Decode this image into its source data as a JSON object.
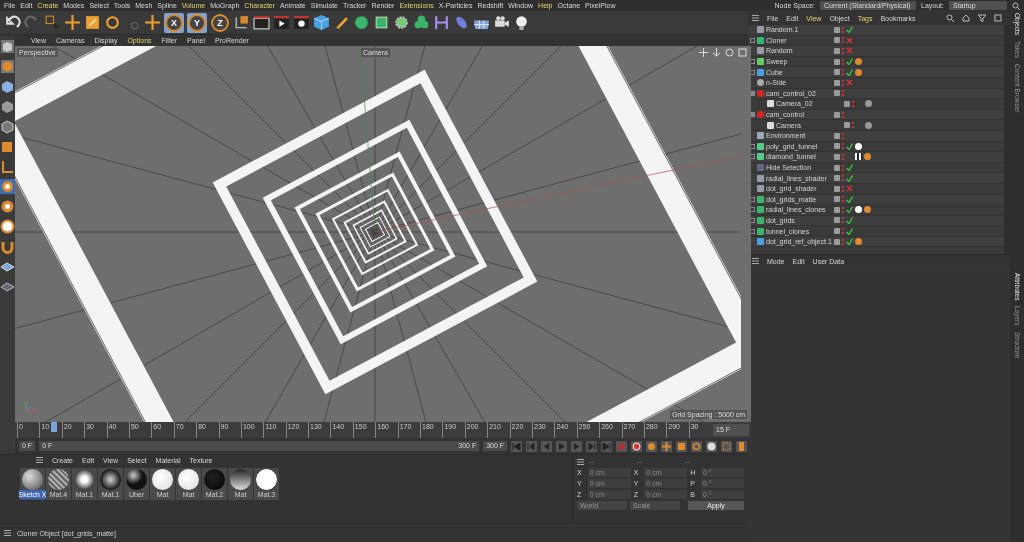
{
  "menubar": {
    "items": [
      {
        "label": "File",
        "highlighted": false
      },
      {
        "label": "Edit",
        "highlighted": false
      },
      {
        "label": "Create",
        "highlighted": true
      },
      {
        "label": "Modes",
        "highlighted": false
      },
      {
        "label": "Select",
        "highlighted": false
      },
      {
        "label": "Tools",
        "highlighted": false
      },
      {
        "label": "Mesh",
        "highlighted": false
      },
      {
        "label": "Spline",
        "highlighted": false
      },
      {
        "label": "Volume",
        "highlighted": true
      },
      {
        "label": "MoGraph",
        "highlighted": false
      },
      {
        "label": "Character",
        "highlighted": true
      },
      {
        "label": "Animate",
        "highlighted": false
      },
      {
        "label": "Simulate",
        "highlighted": false
      },
      {
        "label": "Tracker",
        "highlighted": false
      },
      {
        "label": "Render",
        "highlighted": false
      },
      {
        "label": "Extensions",
        "highlighted": true
      },
      {
        "label": "X-Particles",
        "highlighted": false
      },
      {
        "label": "Redshift",
        "highlighted": false
      },
      {
        "label": "Window",
        "highlighted": false
      },
      {
        "label": "Help",
        "highlighted": true
      },
      {
        "label": "Octane",
        "highlighted": false
      },
      {
        "label": "PixelPlow",
        "highlighted": false
      }
    ]
  },
  "node_space": {
    "label": "Node Space:",
    "value": "Current (Standard/Physical)"
  },
  "layout": {
    "label": "Layout:",
    "value": "Startup"
  },
  "toolbar": {
    "axis_locks": [
      {
        "label": "X",
        "selected": true
      },
      {
        "label": "Y",
        "selected": true
      },
      {
        "label": "Z",
        "selected": false
      }
    ]
  },
  "viewport": {
    "menu": [
      {
        "label": "View",
        "highlighted": false
      },
      {
        "label": "Cameras",
        "highlighted": false
      },
      {
        "label": "Display",
        "highlighted": false
      },
      {
        "label": "Options",
        "highlighted": true
      },
      {
        "label": "Filter",
        "highlighted": false
      },
      {
        "label": "Panel",
        "highlighted": false
      },
      {
        "label": "ProRender",
        "highlighted": false
      }
    ],
    "view_name": "Perspective",
    "camera_label": "Camera",
    "grid_spacing": "Grid Spacing : 5000 cm"
  },
  "timeline": {
    "ticks": [
      "0",
      "10",
      "20",
      "30",
      "40",
      "50",
      "60",
      "70",
      "80",
      "90",
      "100",
      "110",
      "120",
      "130",
      "140",
      "150",
      "160",
      "170",
      "180",
      "190",
      "200",
      "210",
      "220",
      "230",
      "240",
      "250",
      "260",
      "270",
      "280",
      "290",
      "30"
    ],
    "playhead": {
      "level": 0.05
    },
    "frame_field": "15 F"
  },
  "transport": {
    "start": "0 F",
    "current": "0 F",
    "range_end": "300 F",
    "end": "300 F"
  },
  "material_manager": {
    "menu": [
      "Create",
      "Edit",
      "View",
      "Select",
      "Material",
      "Texture"
    ],
    "materials": [
      {
        "name": "Sketch X",
        "kind": "sketch",
        "selected": true
      },
      {
        "name": "Mat.4",
        "kind": "grid",
        "selected": false
      },
      {
        "name": "Mat.1",
        "kind": "glow",
        "selected": false
      },
      {
        "name": "Mat.1",
        "kind": "dark",
        "selected": false
      },
      {
        "name": "Uber",
        "kind": "glossy",
        "selected": false
      },
      {
        "name": "Mat",
        "kind": "white",
        "selected": false
      },
      {
        "name": "Mat",
        "kind": "white",
        "selected": false
      },
      {
        "name": "Mat.2",
        "kind": "black",
        "selected": false
      },
      {
        "name": "Mat",
        "kind": "gradient",
        "selected": false
      },
      {
        "name": "Mat.3",
        "kind": "ring",
        "selected": false
      }
    ]
  },
  "coordinates": {
    "headers": [
      "--",
      "--",
      "--"
    ],
    "rows": [
      {
        "axis": "X",
        "position": "0 cm",
        "size_axis": "X",
        "size": "0 cm",
        "rotation_axis": "H",
        "rotation": "0 °"
      },
      {
        "axis": "Y",
        "position": "0 cm",
        "size_axis": "Y",
        "size": "0 cm",
        "rotation_axis": "P",
        "rotation": "0 °"
      },
      {
        "axis": "Z",
        "position": "0 cm",
        "size_axis": "Z",
        "size": "0 cm",
        "rotation_axis": "B",
        "rotation": "0 °"
      }
    ],
    "mode": "World",
    "size_mode": "Scale",
    "apply": "Apply"
  },
  "status_bar": {
    "text": "Cloner Object [dot_grids_matte]"
  },
  "object_manager": {
    "menu": [
      {
        "label": "File",
        "highlighted": false
      },
      {
        "label": "Edit",
        "highlighted": false
      },
      {
        "label": "View",
        "highlighted": true
      },
      {
        "label": "Object",
        "highlighted": false
      },
      {
        "label": "Tags",
        "highlighted": true
      },
      {
        "label": "Bookmarks",
        "highlighted": false
      }
    ],
    "objects": [
      {
        "name": "Random.1",
        "kind": "random",
        "enabled": true
      },
      {
        "name": "Cloner",
        "kind": "cloner",
        "expanded": false,
        "enabled": false
      },
      {
        "name": "Random",
        "kind": "random",
        "enabled": false
      },
      {
        "name": "Sweep",
        "kind": "sweep",
        "expanded": false,
        "enabled": true,
        "tags": [
          {
            "kind": "phong"
          }
        ]
      },
      {
        "name": "Cube",
        "kind": "cube",
        "expanded": false,
        "enabled": true,
        "tags": [
          {
            "kind": "phong"
          }
        ]
      },
      {
        "name": "n-Side",
        "kind": "spline",
        "enabled": false
      },
      {
        "name": "cam_control_02",
        "kind": "null",
        "expanded": true,
        "children": [
          {
            "name": "Camera_02",
            "kind": "camera",
            "tags": [
              {
                "kind": "target"
              }
            ]
          }
        ]
      },
      {
        "name": "cam_control",
        "kind": "null",
        "expanded": true,
        "children": [
          {
            "name": "Camera",
            "kind": "camera",
            "tags": [
              {
                "kind": "target"
              }
            ]
          }
        ]
      },
      {
        "name": "Environment",
        "kind": "environment"
      },
      {
        "name": "poly_grid_tunnel",
        "kind": "instance",
        "expanded": false,
        "enabled": true,
        "tags": [
          {
            "kind": "material"
          }
        ]
      },
      {
        "name": "diamond_tunnel",
        "kind": "instance",
        "expanded": false,
        "tags": [
          {
            "kind": "checker"
          },
          {
            "kind": "phong"
          }
        ]
      },
      {
        "name": "Hide Selection",
        "kind": "display",
        "enabled": true
      },
      {
        "name": "radial_lines_shader",
        "kind": "shader",
        "enabled": true
      },
      {
        "name": "dot_grid_shader",
        "kind": "shader",
        "enabled": false
      },
      {
        "name": "dot_grids_matte",
        "kind": "cloner",
        "expanded": false,
        "enabled": true
      },
      {
        "name": "radial_lines_clones",
        "kind": "cloner",
        "expanded": false,
        "enabled": true,
        "tags": [
          {
            "kind": "material"
          },
          {
            "kind": "phong"
          }
        ]
      },
      {
        "name": "dot_grids",
        "kind": "cloner",
        "expanded": false,
        "enabled": true
      },
      {
        "name": "tunnel_clones",
        "kind": "cloner",
        "expanded": false,
        "enabled": true
      },
      {
        "name": "dot_grid_ref_object.1",
        "kind": "cylinder",
        "enabled": true,
        "tags": [
          {
            "kind": "phong"
          }
        ]
      }
    ]
  },
  "attributes": {
    "menu": [
      "Mode",
      "Edit",
      "User Data"
    ]
  },
  "side_tabs": {
    "top": [
      {
        "label": "Objects",
        "selected": true
      },
      {
        "label": "Takes",
        "selected": false
      },
      {
        "label": "Content Browser",
        "selected": false
      }
    ],
    "bottom": [
      {
        "label": "Attributes",
        "selected": true
      },
      {
        "label": "Layers",
        "selected": false
      },
      {
        "label": "Structure",
        "selected": false
      }
    ]
  }
}
